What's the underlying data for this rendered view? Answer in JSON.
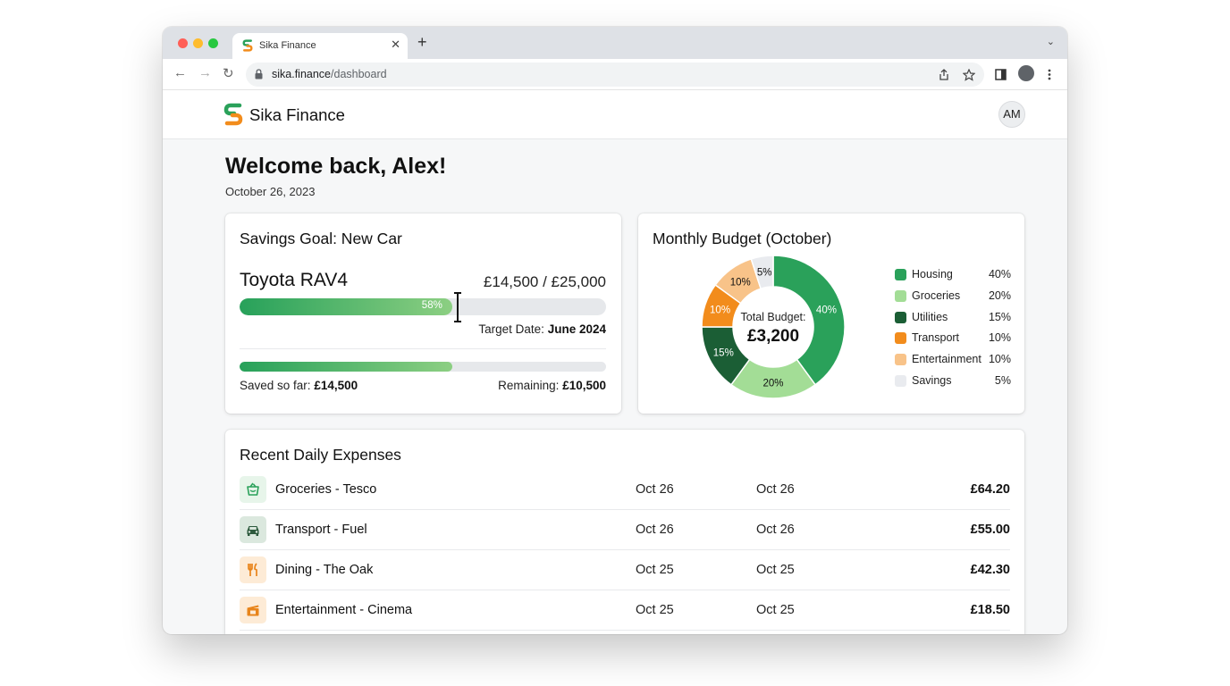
{
  "browser": {
    "tab_title": "Sika Finance",
    "tab_close": "✕",
    "new_tab": "+",
    "tab_menu": "⌄",
    "url_domain": "sika.finance",
    "url_path": "/dashboard",
    "nav": {
      "back": "←",
      "forward": "→",
      "reload": "↻"
    },
    "icons": [
      "share-icon",
      "star-icon",
      "sidepanel-icon",
      "profile-icon",
      "more-menu-icon"
    ]
  },
  "header": {
    "brand": "Sika Finance",
    "avatar_initials": "AM"
  },
  "welcome": {
    "title": "Welcome back, Alex!",
    "date": "October 26, 2023"
  },
  "savings": {
    "title": "Savings Goal: New Car",
    "goal_name": "Toyota RAV4",
    "amount": "£14,500 / £25,000",
    "progress_percent": 58,
    "progress_label": "58%",
    "target_label": "Target Date:",
    "target_date": "June 2024",
    "saved_fraction": 0.58,
    "saved_label": "Saved so far:",
    "saved_value": "£14,500",
    "remaining_label": "Remaining:",
    "remaining_value": "£10,500"
  },
  "budget": {
    "title": "Monthly Budget (October)",
    "center_label": "Total Budget:",
    "center_value": "£3,200"
  },
  "chart_data": {
    "type": "pie",
    "title": "Monthly Budget (October)",
    "categories": [
      "Housing",
      "Groceries",
      "Utilities",
      "Transport",
      "Entertainment",
      "Savings"
    ],
    "values": [
      40,
      20,
      15,
      10,
      10,
      5
    ],
    "labels": [
      "40%",
      "20%",
      "15%",
      "10%",
      "10%",
      "5%"
    ],
    "colors": [
      "#2aa15a",
      "#a3dd96",
      "#1b5e35",
      "#f28c1c",
      "#f8c389",
      "#e9ebef"
    ],
    "label_colors": [
      "#ffffff",
      "#111111",
      "#ffffff",
      "#ffffff",
      "#111111",
      "#111111"
    ],
    "legend": "right",
    "donut": true
  },
  "expenses": {
    "title": "Recent Daily Expenses",
    "items": [
      {
        "name": "Groceries - Tesco",
        "date1": "Oct 26",
        "date2": "Oct 26",
        "amount": "£64.20",
        "icon": "basket-icon"
      },
      {
        "name": "Transport - Fuel",
        "date1": "Oct 26",
        "date2": "Oct 26",
        "amount": "£55.00",
        "icon": "car-icon"
      },
      {
        "name": "Dining - The Oak",
        "date1": "Oct 25",
        "date2": "Oct 25",
        "amount": "£42.30",
        "icon": "utensils-icon"
      },
      {
        "name": "Entertainment - Cinema",
        "date1": "Oct 25",
        "date2": "Oct 25",
        "amount": "£18.50",
        "icon": "clapperboard-icon"
      }
    ]
  }
}
